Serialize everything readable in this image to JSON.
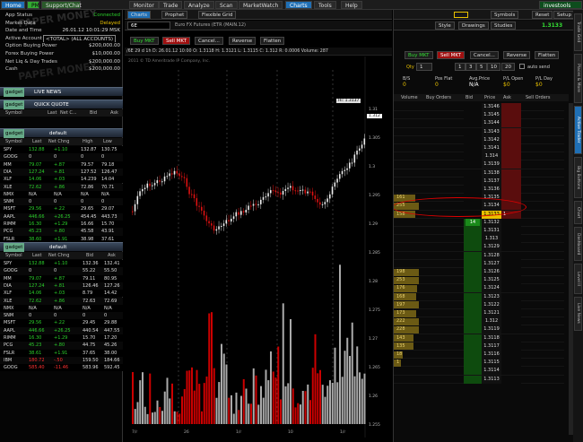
{
  "topnav": {
    "home": "Home",
    "pm": "PM",
    "support": "Support/Chat",
    "tabs": [
      "Monitor",
      "Trade",
      "Analyze",
      "Scan",
      "MarketWatch",
      "Charts",
      "Tools",
      "Help"
    ],
    "active": "Charts",
    "brand": "investools"
  },
  "subtoolbar": {
    "charts_tab": "Charts",
    "prophet_tab": "Prophet",
    "flexible_grid": "Flexible Grid",
    "symbols": "Symbols",
    "reset": "Reset",
    "setup": "Setup"
  },
  "account": {
    "rows": [
      {
        "label": "App Status",
        "value": "Connected"
      },
      {
        "label": "Market Data",
        "value": "Delayed"
      },
      {
        "label": "Date and Time",
        "value": "26.01.12 10:01:29 MSK"
      },
      {
        "label": "Active Account",
        "value": "<TOTAL> (ALL ACCOUNTS)"
      },
      {
        "label": "Option Buying Power",
        "value": "$200,000.00"
      },
      {
        "label": "Forex Buying Power",
        "value": "$10,000.00"
      },
      {
        "label": "Net Liq & Day Trades",
        "value": "$200,000.00"
      },
      {
        "label": "Cash",
        "value": "$200,000.00"
      }
    ],
    "watermark": "PAPER MONEY"
  },
  "gadgets": {
    "live_news": "LIVE NEWS",
    "quick_quote": "QUICK QUOTE",
    "quick_cols": [
      "Symbol",
      "Last",
      "Net C...",
      "Bid",
      "Ask"
    ],
    "watchlist": "default"
  },
  "watch_cols": [
    "Symbol",
    "Last",
    "Net Chng",
    "High",
    "Low"
  ],
  "watch1": [
    {
      "s": "SPY",
      "last": "132.88",
      "chg": "+1.10",
      "h": "132.87",
      "lo": "130.75",
      "c": "up"
    },
    {
      "s": "GOOG",
      "last": "0",
      "chg": "0",
      "h": "0",
      "lo": "0",
      "c": "wh"
    },
    {
      "s": "MM",
      "last": "79.07",
      "chg": "+.87",
      "h": "79.57",
      "lo": "79.18",
      "c": "up"
    },
    {
      "s": "DIA",
      "last": "127.24",
      "chg": "+.81",
      "h": "127.52",
      "lo": "126.47",
      "c": "up"
    },
    {
      "s": "XLF",
      "last": "14.06",
      "chg": "+.03",
      "h": "14.239",
      "lo": "14.04",
      "c": "up"
    },
    {
      "s": "XLE",
      "last": "72.62",
      "chg": "+.86",
      "h": "72.86",
      "lo": "70.71",
      "c": "up"
    },
    {
      "s": "NMX",
      "last": "N/A",
      "chg": "N/A",
      "h": "N/A",
      "lo": "N/A",
      "c": "wh"
    },
    {
      "s": "SNM",
      "last": "0",
      "chg": "0",
      "h": "0",
      "lo": "0",
      "c": "wh"
    },
    {
      "s": "MSFT",
      "last": "29.56",
      "chg": "+.22",
      "h": "29.65",
      "lo": "29.07",
      "c": "up"
    },
    {
      "s": "AAPL",
      "last": "446.66",
      "chg": "+26.25",
      "h": "454.45",
      "lo": "443.73",
      "c": "up"
    },
    {
      "s": "RIMM",
      "last": "16.30",
      "chg": "+1.29",
      "h": "16.66",
      "lo": "15.70",
      "c": "up"
    },
    {
      "s": "PCG",
      "last": "45.23",
      "chg": "+.80",
      "h": "45.58",
      "lo": "43.91",
      "c": "up"
    },
    {
      "s": "FSLR",
      "last": "38.60",
      "chg": "+1.91",
      "h": "38.98",
      "lo": "37.61",
      "c": "up"
    }
  ],
  "watch2_cols": [
    "Symbol",
    "Last",
    "Net Chng",
    "Bid",
    "Ask"
  ],
  "watch2": [
    {
      "s": "SPY",
      "last": "132.88",
      "chg": "+1.10",
      "b": "132.36",
      "a": "132.41",
      "c": "up"
    },
    {
      "s": "GOOG",
      "last": "0",
      "chg": "0",
      "b": "55.22",
      "a": "55.50",
      "c": "wh"
    },
    {
      "s": "MM",
      "last": "79.07",
      "chg": "+.87",
      "b": "79.11",
      "a": "80.95",
      "c": "up"
    },
    {
      "s": "DIA",
      "last": "127.24",
      "chg": "+.81",
      "b": "126.46",
      "a": "127.26",
      "c": "up"
    },
    {
      "s": "XLF",
      "last": "14.06",
      "chg": "+.03",
      "b": "8.79",
      "a": "14.42",
      "c": "up"
    },
    {
      "s": "XLE",
      "last": "72.62",
      "chg": "+.86",
      "b": "72.63",
      "a": "72.69",
      "c": "up"
    },
    {
      "s": "NMX",
      "last": "N/A",
      "chg": "N/A",
      "b": "N/A",
      "a": "N/A",
      "c": "wh"
    },
    {
      "s": "SNM",
      "last": "0",
      "chg": "0",
      "b": "0",
      "a": "0",
      "c": "wh"
    },
    {
      "s": "MSFT",
      "last": "29.56",
      "chg": "+.22",
      "b": "29.45",
      "a": "29.88",
      "c": "up"
    },
    {
      "s": "AAPL",
      "last": "446.66",
      "chg": "+26.25",
      "b": "440.54",
      "a": "447.55",
      "c": "up"
    },
    {
      "s": "RIMM",
      "last": "16.30",
      "chg": "+1.29",
      "b": "15.70",
      "a": "17.20",
      "c": "up"
    },
    {
      "s": "PCG",
      "last": "45.23",
      "chg": "+.80",
      "b": "44.75",
      "a": "45.26",
      "c": "up"
    },
    {
      "s": "FSLR",
      "last": "38.61",
      "chg": "+1.91",
      "b": "37.65",
      "a": "38.00",
      "c": "up"
    },
    {
      "s": "IBM",
      "last": "180.72",
      "chg": "-.50",
      "b": "159.50",
      "a": "184.66",
      "c": "dn"
    },
    {
      "s": "GOOG",
      "last": "585.40",
      "chg": "-11.46",
      "b": "583.96",
      "a": "592.45",
      "c": "dn"
    }
  ],
  "chart": {
    "symbol": "6E",
    "desc": "Euro FX Futures (ETR (MAIN.12)",
    "info": "/6E 29 d 1h  D: 26.01.12 10:00  O: 1.3118  H: 1.3121  L: 1.3115  C: 1.312  R: 0.0006  Volume: 287",
    "copyright": "2011 © TD Ameritrade IP Company, Inc.",
    "last_label": "1.312",
    "hi_label": "Hi: 1.3137",
    "axis_labels": [
      "1.31",
      "1.305",
      "1.3",
      "1.295",
      "1.29",
      "1.285",
      "1.28",
      "1.275",
      "1.27",
      "1.265",
      "1.26",
      "1.255"
    ],
    "date_labels": [
      "7/r",
      "26",
      "1/r",
      "10",
      "1/r"
    ],
    "style": "Style",
    "drawings": "Drawings",
    "studies": "Studies"
  },
  "trade": {
    "buy": "Buy MKT",
    "sell": "Sell MKT",
    "cancel": "Cancel...",
    "reverse": "Reverse",
    "flatten": "Flatten",
    "qty_label": "Qty",
    "qty_options": [
      "1",
      "3",
      "5",
      "10",
      "20"
    ],
    "auto_send": "auto send",
    "last": "1.3133",
    "stats": [
      {
        "l": "B/S",
        "v": "0"
      },
      {
        "l": "Pos Flat",
        "v": "0"
      },
      {
        "l": "Avg.Price",
        "v": "N/A"
      },
      {
        "l": "P/L Open",
        "v": "$0"
      },
      {
        "l": "P/L Day",
        "v": "$0"
      }
    ],
    "cols": [
      "Volume",
      "Buy Orders",
      "Bid",
      "Price",
      "Ask",
      "Sell Orders"
    ]
  },
  "ladder": [
    {
      "p": "1.3146",
      "v": ""
    },
    {
      "p": "1.3145",
      "v": ""
    },
    {
      "p": "1.3144",
      "v": ""
    },
    {
      "p": "1.3143",
      "v": ""
    },
    {
      "p": "1.3142",
      "v": ""
    },
    {
      "p": "1.3141",
      "v": ""
    },
    {
      "p": "1.314",
      "v": ""
    },
    {
      "p": "1.3139",
      "v": ""
    },
    {
      "p": "1.3138",
      "v": ""
    },
    {
      "p": "1.3137",
      "v": ""
    },
    {
      "p": "1.3136",
      "v": ""
    },
    {
      "p": "1.3135",
      "v": "161"
    },
    {
      "p": "1.3134",
      "v": "255"
    },
    {
      "p": "1.3133",
      "v": "158"
    },
    {
      "p": "1.3132",
      "v": ""
    },
    {
      "p": "1.3131",
      "v": ""
    },
    {
      "p": "1.313",
      "v": ""
    },
    {
      "p": "1.3129",
      "v": ""
    },
    {
      "p": "1.3128",
      "v": ""
    },
    {
      "p": "1.3127",
      "v": ""
    },
    {
      "p": "1.3126",
      "v": "198"
    },
    {
      "p": "1.3125",
      "v": "253"
    },
    {
      "p": "1.3124",
      "v": "176"
    },
    {
      "p": "1.3123",
      "v": "168"
    },
    {
      "p": "1.3122",
      "v": "197"
    },
    {
      "p": "1.3121",
      "v": "173"
    },
    {
      "p": "1.312",
      "v": "222"
    },
    {
      "p": "1.3119",
      "v": "228"
    },
    {
      "p": "1.3118",
      "v": "143"
    },
    {
      "p": "1.3117",
      "v": "135"
    },
    {
      "p": "1.3116",
      "v": "18"
    },
    {
      "p": "1.3115",
      "v": "1"
    },
    {
      "p": "1.3114",
      "v": ""
    },
    {
      "p": "1.3113",
      "v": ""
    }
  ],
  "bid_marker": "14",
  "ask_marker": "1",
  "vtabs": [
    "Trade Grid",
    "Places & More",
    "Active Trader",
    "Big Buttons",
    "Chart",
    "Dashboard",
    "Level II",
    "Live News"
  ]
}
